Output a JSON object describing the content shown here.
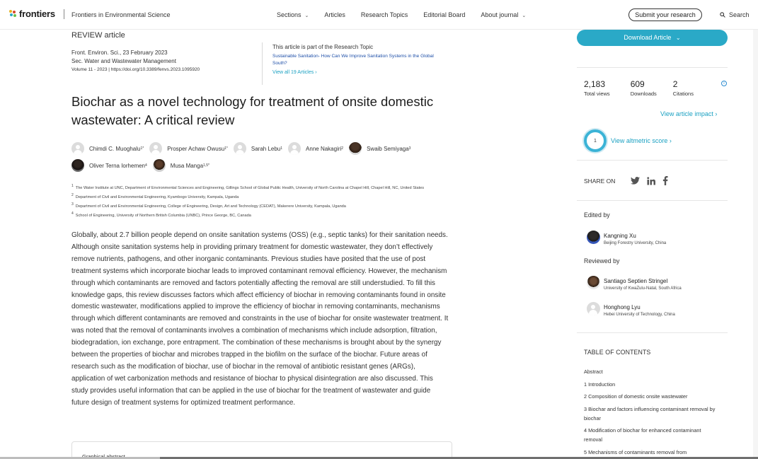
{
  "nav": {
    "logo_text": "frontiers",
    "journal": "Frontiers in Environmental Science",
    "items": [
      {
        "label": "Sections",
        "has_chevron": true
      },
      {
        "label": "Articles",
        "has_chevron": false
      },
      {
        "label": "Research Topics",
        "has_chevron": false
      },
      {
        "label": "Editorial Board",
        "has_chevron": false
      },
      {
        "label": "About journal",
        "has_chevron": true
      }
    ],
    "submit_label": "Submit your research",
    "search_label": "Search"
  },
  "article": {
    "type": "REVIEW article",
    "journal_line": "Front. Environ. Sci., 23 February 2023",
    "section_line": "Sec. Water and Wastewater Management",
    "volume_line": "Volume 11 - 2023 | https://doi.org/10.3389/fenvs.2023.1095920",
    "research_topic_intro": "This article is part of the Research Topic",
    "research_topic_title": "Sustainable Sanitation- How Can We Improve Sanitation Systems in the Global South?",
    "view_all": "View all 19 Articles",
    "title": "Biochar as a novel technology for treatment of onsite domestic wastewater: A critical review",
    "authors_row1": [
      {
        "name": "Chimdi C. Muoghalu",
        "sup": "1*",
        "photo": "blank"
      },
      {
        "name": "Prosper Achaw Owusu",
        "sup": "1*",
        "photo": "blank"
      },
      {
        "name": "Sarah Lebu",
        "sup": "1",
        "photo": "blank"
      },
      {
        "name": "Anne Nakagiri",
        "sup": "2",
        "photo": "blank"
      },
      {
        "name": "Swaib Semiyaga",
        "sup": "3",
        "photo": "photo-a"
      }
    ],
    "authors_row2": [
      {
        "name": "Oliver Terna Iorhemen",
        "sup": "4",
        "photo": "photo-b"
      },
      {
        "name": "Musa Manga",
        "sup": "1,5*",
        "photo": "photo-c"
      }
    ],
    "affiliations": [
      {
        "num": "1",
        "text": "The Water Institute at UNC, Department of Environmental Sciences and Engineering, Gillings School of Global Public Health, University of North Carolina at Chapel Hill, Chapel Hill, NC, United States"
      },
      {
        "num": "2",
        "text": "Department of Civil and Environmental Engineering, Kyambogo University, Kampala, Uganda"
      },
      {
        "num": "3",
        "text": "Department of Civil and Environmental Engineering, College of Engineering, Design, Art and Technology (CEDAT), Makerere University, Kampala, Uganda"
      },
      {
        "num": "4",
        "text": "School of Engineering, University of Northern British Columbia (UNBC), Prince George, BC, Canada"
      }
    ],
    "abstract": "Globally, about 2.7 billion people depend on onsite sanitation systems (OSS) (e.g., septic tanks) for their sanitation needs. Although onsite sanitation systems help in providing primary treatment for domestic wastewater, they don’t effectively remove nutrients, pathogens, and other inorganic contaminants. Previous studies have posited that the use of post treatment systems which incorporate biochar leads to improved contaminant removal efficiency. However, the mechanism through which contaminants are removed and factors potentially affecting the removal are still understudied. To fill this knowledge gaps, this review discusses factors which affect efficiency of biochar in removing contaminants found in onsite domestic wastewater, modifications applied to improve the efficiency of biochar in removing contaminants, mechanisms through which different contaminants are removed and constraints in the use of biochar for onsite wastewater treatment. It was noted that the removal of contaminants involves a combination of mechanisms which include adsorption, filtration, biodegradation, ion exchange, pore entrapment. The combination of these mechanisms is brought about by the synergy between the properties of biochar and microbes trapped in the biofilm on the surface of the biochar. Future areas of research such as the modification of biochar, use of biochar in the removal of antibiotic resistant genes (ARGs), application of wet carbonization methods and resistance of biochar to physical disintegration are also discussed. This study provides useful information that can be applied in the use of biochar for the treatment of wastewater and guide future design of treatment systems for optimized treatment performance.",
    "graphical_abstract_label": "Graphical abstract"
  },
  "sidebar": {
    "download_label": "Download Article",
    "metrics": [
      {
        "value": "2,183",
        "label": "Total views"
      },
      {
        "value": "609",
        "label": "Downloads"
      },
      {
        "value": "2",
        "label": "Citations"
      }
    ],
    "impact_link": "View article impact",
    "altmetric_score": "1",
    "altmetric_link": "View altmetric score",
    "share_label": "SHARE ON",
    "edited_by_label": "Edited by",
    "editor": {
      "name": "Kangning Xu",
      "affiliation": "Beijing Forestry University, China"
    },
    "reviewed_by_label": "Reviewed by",
    "reviewers": [
      {
        "name": "Santiago Septien Stringel",
        "affiliation": "University of KwaZulu-Natal, South Africa"
      },
      {
        "name": "Honghong Lyu",
        "affiliation": "Hebei University of Technology, China"
      }
    ],
    "toc_label": "TABLE OF CONTENTS",
    "toc_items": [
      "Abstract",
      "1 Introduction",
      "2 Composition of domestic onsite wastewater",
      "3 Biochar and factors influencing contaminant removal by biochar",
      "4 Modification of biochar for enhanced contaminant removal",
      "5 Mechanisms of contaminants removal from"
    ]
  },
  "colors": {
    "accent": "#2aa9c7",
    "link": "#1ba1c2"
  }
}
